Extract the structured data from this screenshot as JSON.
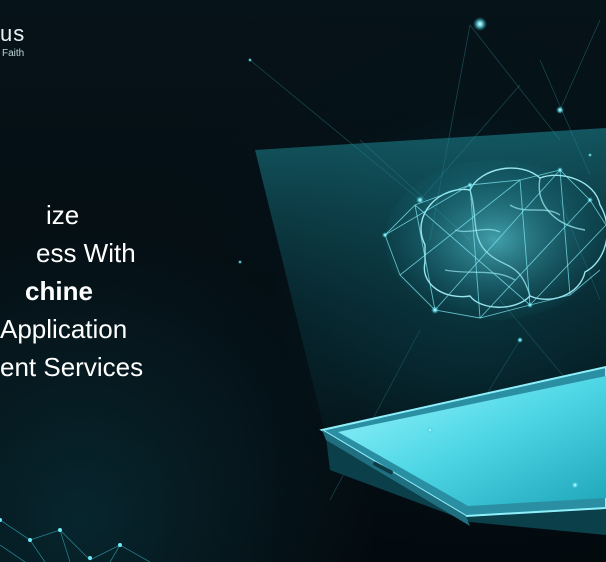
{
  "brand": {
    "name_fragment": "us",
    "tagline_fragment": "Faith"
  },
  "headline": {
    "line1": "ize",
    "line2": "ess With",
    "line3": "chine",
    "line4": "Application",
    "line5": "ent Services"
  },
  "colors": {
    "background": "#03090d",
    "accent": "#4fe6f0",
    "phone_edge": "#5ad2e2"
  },
  "icons": {
    "hero": "brain-icon",
    "device": "smartphone-icon"
  }
}
